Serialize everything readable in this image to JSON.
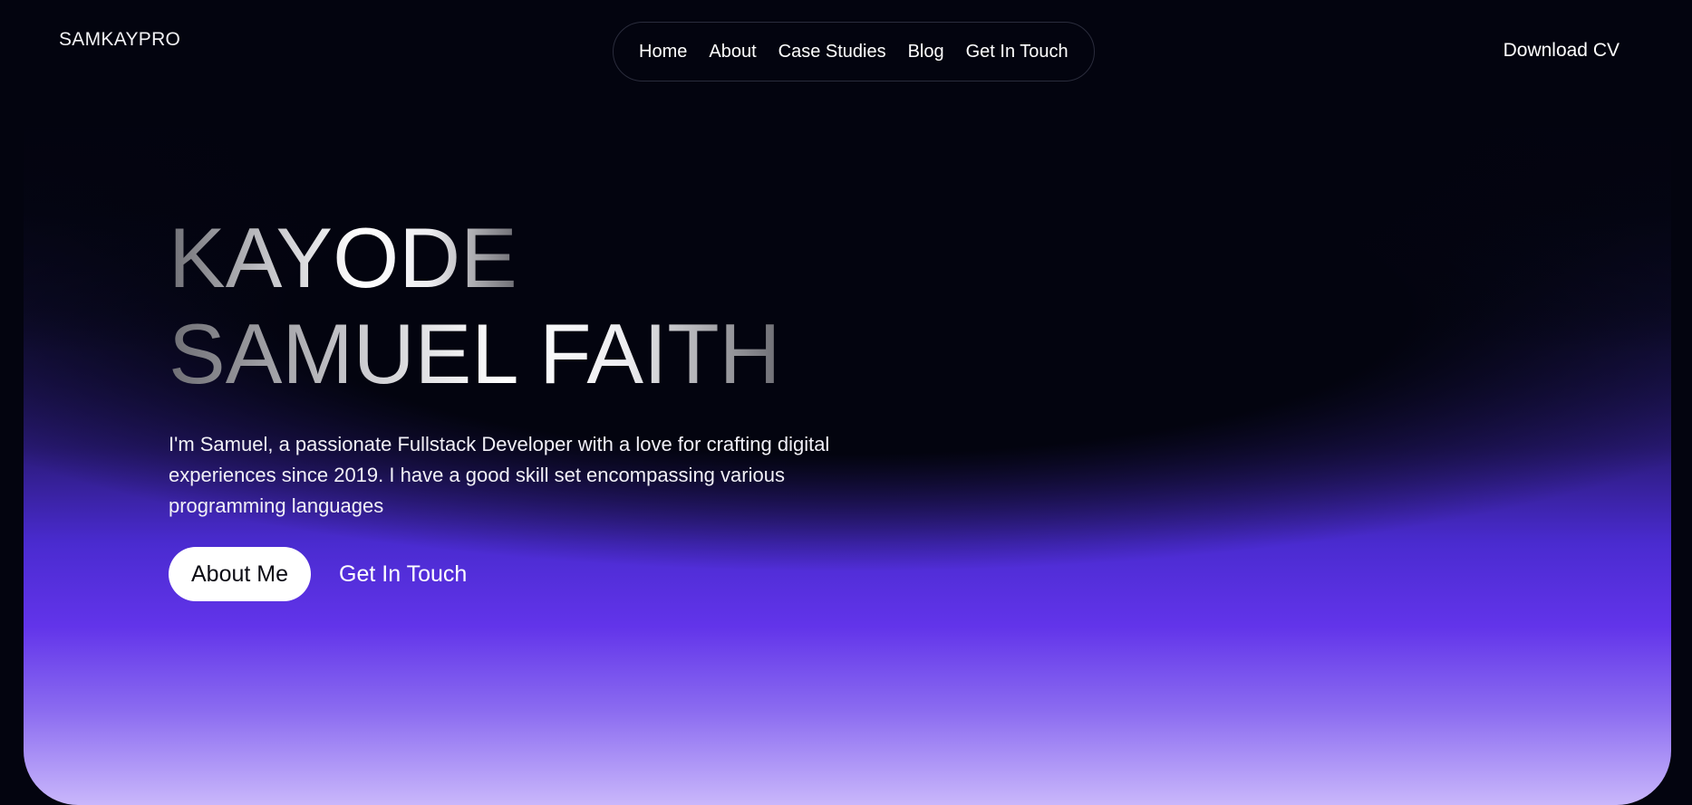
{
  "header": {
    "logo": "SAMKAYPRO",
    "nav": [
      {
        "label": "Home"
      },
      {
        "label": "About"
      },
      {
        "label": "Case Studies"
      },
      {
        "label": "Blog"
      },
      {
        "label": "Get In Touch"
      }
    ],
    "download_label": "Download CV"
  },
  "hero": {
    "name_line_1": "KAYODE",
    "name_line_2": "SAMUEL FAITH",
    "intro": "I'm Samuel, a passionate Fullstack Developer with a love for crafting digital experiences since 2019. I have a good skill set encompassing various programming languages",
    "primary_button": "About Me",
    "secondary_link": "Get In Touch"
  },
  "colors": {
    "background": "#03040f",
    "accent_purple": "#6234ea",
    "glow_light": "#c9b7fb"
  }
}
